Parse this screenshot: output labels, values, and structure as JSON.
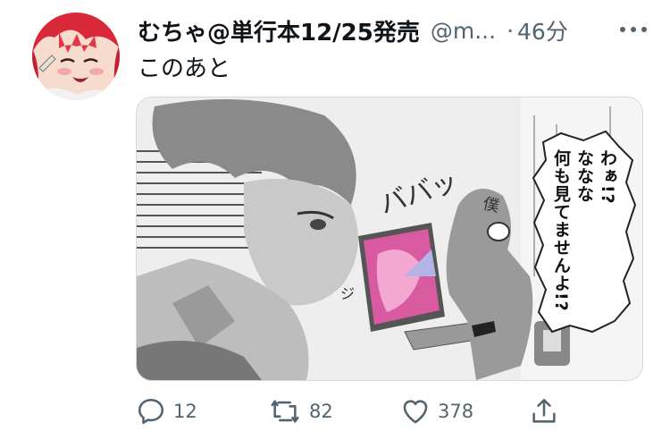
{
  "tweet": {
    "display_name": "むちゃ@単行本12/25発売",
    "handle": "@m...",
    "separator": "·",
    "timestamp": "46分",
    "text": "このあと",
    "avatar_icon": "anime-avatar-icon",
    "media": {
      "speech_lines": [
        "わぁ!?",
        "ななな",
        "何も見てませんよ!?"
      ],
      "sfx_main": "ババッ",
      "sfx_small": "ジ",
      "sfx_kanji": "僕"
    },
    "actions": {
      "reply": {
        "icon": "reply-icon",
        "count": "12"
      },
      "retweet": {
        "icon": "retweet-icon",
        "count": "82"
      },
      "like": {
        "icon": "heart-icon",
        "count": "378"
      },
      "share": {
        "icon": "share-icon"
      }
    },
    "colors": {
      "text": "#0f1419",
      "secondary": "#536471",
      "border": "#cfd9de"
    }
  }
}
